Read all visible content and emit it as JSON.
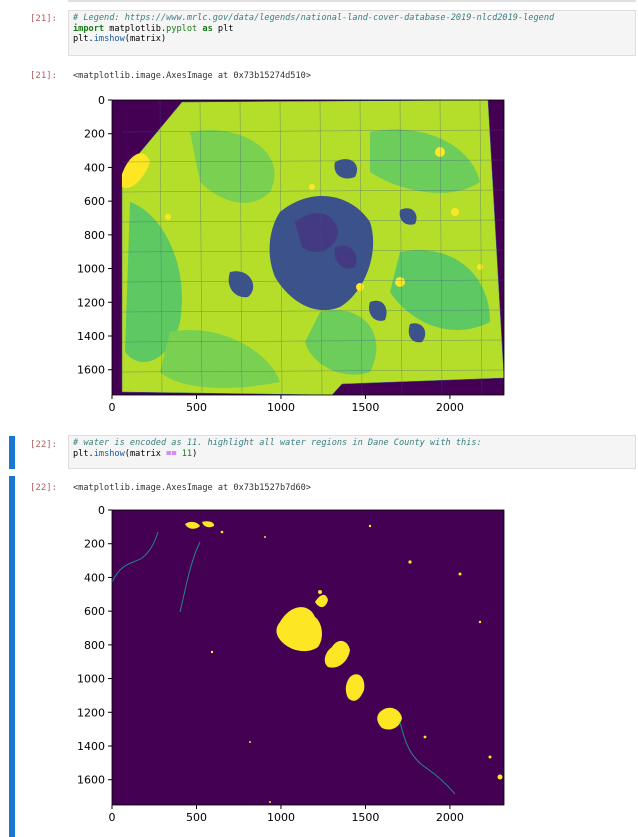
{
  "cells": [
    {
      "prompt_in": "[21]:",
      "code_lines": [
        [
          {
            "t": "comment",
            "v": "# Legend: https://www.mrlc.gov/data/legends/national-land-cover-database-2019-nlcd2019-legend"
          }
        ],
        [
          {
            "t": "kw",
            "v": "import"
          },
          {
            "t": "plain",
            "v": " matplotlib"
          },
          {
            "t": "plain",
            "v": "."
          },
          {
            "t": "nm",
            "v": "pyplot"
          },
          {
            "t": "plain",
            "v": " "
          },
          {
            "t": "kw",
            "v": "as"
          },
          {
            "t": "plain",
            "v": " plt"
          }
        ],
        [
          {
            "t": "plain",
            "v": "plt"
          },
          {
            "t": "plain",
            "v": "."
          },
          {
            "t": "fn",
            "v": "imshow"
          },
          {
            "t": "plain",
            "v": "(matrix)"
          }
        ]
      ],
      "prompt_out": "[21]:",
      "output_repr": "<matplotlib.image.AxesImage at 0x73b15274d510>",
      "plot": {
        "x_ticks": [
          "0",
          "500",
          "1000",
          "1500",
          "2000"
        ],
        "y_ticks": [
          "0",
          "200",
          "400",
          "600",
          "800",
          "1000",
          "1200",
          "1400",
          "1600"
        ],
        "image": "nlcd-land-cover-raster"
      }
    },
    {
      "prompt_in": "[22]:",
      "code_lines": [
        [
          {
            "t": "comment",
            "v": "# water is encoded as 11. highlight all water regions in Dane County with this:"
          }
        ],
        [
          {
            "t": "plain",
            "v": "plt"
          },
          {
            "t": "plain",
            "v": "."
          },
          {
            "t": "fn",
            "v": "imshow"
          },
          {
            "t": "plain",
            "v": "(matrix "
          },
          {
            "t": "op",
            "v": "=="
          },
          {
            "t": "plain",
            "v": " "
          },
          {
            "t": "nm",
            "v": "11"
          },
          {
            "t": "plain",
            "v": ")"
          }
        ]
      ],
      "prompt_out": "[22]:",
      "output_repr": "<matplotlib.image.AxesImage at 0x73b1527b7d60>",
      "plot": {
        "x_ticks": [
          "0",
          "500",
          "1000",
          "1500",
          "2000"
        ],
        "y_ticks": [
          "0",
          "200",
          "400",
          "600",
          "800",
          "1000",
          "1200",
          "1400",
          "1600"
        ],
        "image": "water-mask-raster"
      }
    }
  ],
  "colors": {
    "selected_bar": "#1976d2",
    "viridis_dark": "#440154",
    "viridis_mid": "#3b528b",
    "viridis_green": "#5ec962",
    "viridis_yellow": "#fde725"
  }
}
